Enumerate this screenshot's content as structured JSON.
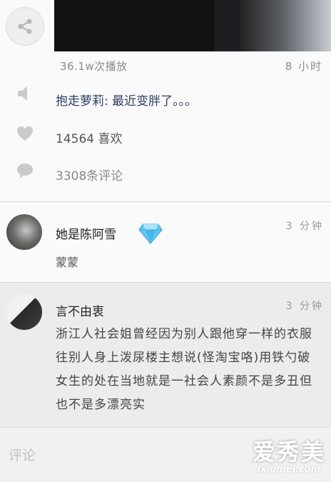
{
  "post": {
    "play_count": "36.1w次播放",
    "time_ago": "8 小时",
    "title": "抱走萝莉: 最近变胖了。。。",
    "likes": "14564 喜欢",
    "comments_count": "3308条评论"
  },
  "comments": [
    {
      "name": "她是陈阿雪",
      "time": "3 分钟",
      "text": "蒙蒙",
      "badge_icon": "diamond-icon"
    },
    {
      "name": "言不由衷",
      "time": "3 分钟",
      "text": "浙江人社会姐曾经因为别人跟他穿一样的衣服往别人身上泼尿楼主想说(怪淘宝咯)用铁勺破女生的处在当地就是一社会人素颜不是多丑但也不是多漂亮实"
    }
  ],
  "input": {
    "placeholder": "评论"
  },
  "watermark": {
    "cn": "爱秀美",
    "en": "ixiumei.com"
  },
  "colors": {
    "accent_title": "#2f3e66",
    "comment_highlight_bg": "#ececec",
    "diamond": "#5fc2f0"
  }
}
